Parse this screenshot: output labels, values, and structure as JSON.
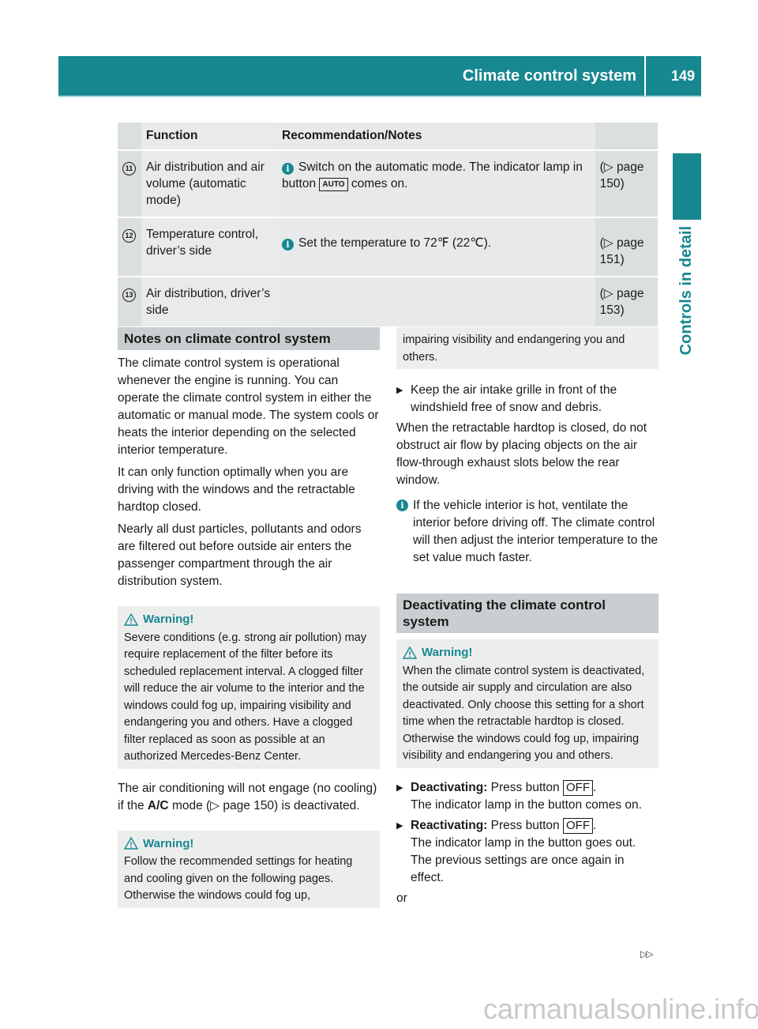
{
  "header": {
    "title": "Climate control system",
    "page_number": "149"
  },
  "side_tab": {
    "label": "Controls in detail"
  },
  "table": {
    "headers": [
      "Function",
      "Recommendation/Notes"
    ],
    "rows": [
      {
        "num": "11",
        "function": "Air distribution and air volume (automatic mode)",
        "note_pre": "Switch on the automatic mode. The indicator lamp in button",
        "note_key": "AUTO",
        "note_post": "comes on.",
        "ref": "(▷ page 150)"
      },
      {
        "num": "12",
        "function": "Temperature control, driver’s side",
        "note_pre": "Set the temperature to 72℉ (22℃).",
        "note_key": "",
        "note_post": "",
        "ref": "(▷ page 151)"
      },
      {
        "num": "13",
        "function": "Air distribution, driver’s side",
        "note_pre": "",
        "note_key": "",
        "note_post": "",
        "ref": "(▷ page 153)"
      }
    ]
  },
  "notes": {
    "heading": "Notes on climate control system",
    "p1": "The climate control system is operational whenever the engine is running. You can operate the climate control system in either the automatic or manual mode. The system cools or heats the interior depending on the selected interior temperature.",
    "p2": "It can only function optimally when you are driving with the windows and the retractable hardtop closed.",
    "p3": "Nearly all dust particles, pollutants and odors are filtered out before outside air enters the passenger compartment through the air distribution system.",
    "warning1": {
      "title": "Warning!",
      "text": "Severe conditions (e.g. strong air pollution) may require replacement of the filter before its scheduled replacement interval. A clogged filter will reduce the air volume to the interior and the windows could fog up, impairing visibility and endangering you and others. Have a clogged filter replaced as soon as possible at an authorized Mercedes-Benz Center."
    },
    "ac_pre": "The air conditioning will not engage (no cooling) if the",
    "ac_bold": "A/C",
    "ac_post": "mode (▷ page 150) is deactivated.",
    "warning2": {
      "title": "Warning!",
      "text": "Follow the recommended settings for heating and cooling given on the following pages. Otherwise the windows could fog up,",
      "continued": "impairing visibility and endangering you and others."
    },
    "bullet1": "Keep the air intake grille in front of the windshield free of snow and debris.",
    "p4": "When the retractable hardtop is closed, do not obstruct air flow by placing objects on the air flow-through exhaust slots below the rear window.",
    "info": "If the vehicle interior is hot, ventilate the interior before driving off. The climate control will then adjust the interior temperature to the set value much faster."
  },
  "deactivating": {
    "heading": "Deactivating the climate control system",
    "warning": {
      "title": "Warning!",
      "text": "When the climate control system is deactivated, the outside air supply and circulation are also deactivated. Only choose this setting for a short time when the retractable hardtop is closed. Otherwise the windows could fog up, impairing visibility and endangering you and others."
    },
    "step1_bold": "Deactivating:",
    "step1_text": "Press button",
    "step1_key": "OFF",
    "step1_result": "The indicator lamp in the button comes on.",
    "step2_bold": "Reactivating:",
    "step2_text": "Press button",
    "step2_key": "OFF",
    "step2_result": "The indicator lamp in the button goes out. The previous settings are once again in effect.",
    "or": "or"
  },
  "footer": {
    "next_page_symbol": "▷▷",
    "watermark": "carmanualsonline.info"
  }
}
